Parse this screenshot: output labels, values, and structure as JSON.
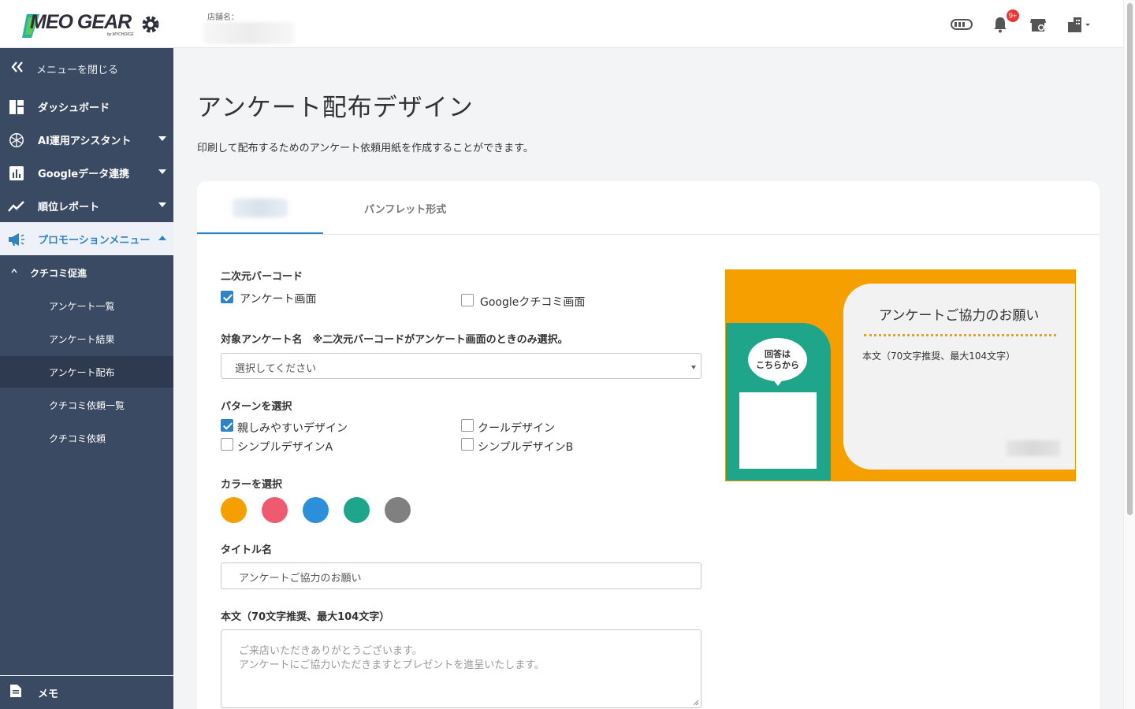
{
  "header": {
    "logo_text": "MEO GEAR",
    "logo_sub": "by MYCHOICE",
    "store_label": "店舗名：",
    "notification_badge": "9+",
    "icons": [
      "toggle-icon",
      "bell-icon",
      "store-icon",
      "building-icon"
    ]
  },
  "sidebar": {
    "close_label": "メニューを閉じる",
    "items": [
      {
        "label": "ダッシュボード",
        "icon": "dashboard-icon"
      },
      {
        "label": "AI運用アシスタント",
        "icon": "ai-icon"
      },
      {
        "label": "Googleデータ連携",
        "icon": "bar-chart-icon"
      },
      {
        "label": "順位レポート",
        "icon": "trend-icon"
      },
      {
        "label": "プロモーションメニュー",
        "icon": "megaphone-icon"
      }
    ],
    "sub_parent": "クチコミ促進",
    "sub_items": [
      "アンケート一覧",
      "アンケート結果",
      "アンケート配布",
      "クチコミ依頼一覧",
      "クチコミ依頼"
    ],
    "memo_label": "メモ"
  },
  "main": {
    "title": "アンケート配布デザイン",
    "description": "印刷して配布するためのアンケート依頼用紙を作成することができます。",
    "tab2": "パンフレット形式",
    "qr_label": "二次元バーコード",
    "qr_options": [
      {
        "label": "アンケート画面",
        "checked": true
      },
      {
        "label": "Googleクチコミ画面",
        "checked": false
      }
    ],
    "target_label": "対象アンケート名　※二次元バーコードがアンケート画面のときのみ選択。",
    "target_select": "選択してください",
    "pattern_label": "パターンを選択",
    "patterns": [
      {
        "label": "親しみやすいデザイン",
        "checked": true
      },
      {
        "label": "クールデザイン",
        "checked": false
      },
      {
        "label": "シンプルデザインA",
        "checked": false
      },
      {
        "label": "シンプルデザインB",
        "checked": false
      }
    ],
    "color_label": "カラーを選択",
    "colors": [
      "#f5a000",
      "#f05a6e",
      "#2d8fd9",
      "#1fa58a",
      "#808080"
    ],
    "title_label": "タイトル名",
    "title_value": "アンケートご協力のお願い",
    "body_label": "本文（70文字推奨、最大104文字）",
    "body_placeholder": "ご来店いただきありがとうございます。\nアンケートにご協力いただきますとプレゼントを進呈いたします。"
  },
  "preview": {
    "bubble_line1": "回答は",
    "bubble_line2": "こちらから",
    "title": "アンケートご協力のお願い",
    "body": "本文（70文字推奨、最大104文字）"
  }
}
